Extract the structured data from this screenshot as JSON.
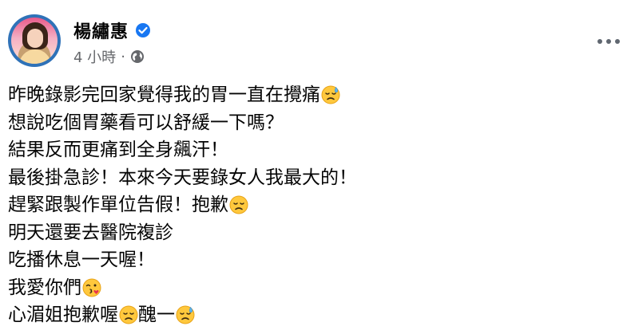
{
  "post": {
    "author_name": "楊繡惠",
    "timestamp": "4 小時",
    "separator": "·",
    "verified_icon": "verified-badge-icon",
    "privacy_icon": "globe-icon",
    "more_icon": "more-options-icon",
    "colors": {
      "verified": "#1877f2",
      "meta_text": "#65676b",
      "body_text": "#050505",
      "avatar_ring": "#2f72b8"
    },
    "lines": [
      {
        "text": "昨晚錄影完回家覺得我的胃一直在攪痛",
        "emoji": "downcast-sweat-face"
      },
      {
        "text": "想說吃個胃藥看可以舒緩一下嗎？",
        "emoji": ""
      },
      {
        "text": "結果反而更痛到全身飆汗！",
        "emoji": ""
      },
      {
        "text": "最後掛急診！本來今天要錄女人我最大的！",
        "emoji": ""
      },
      {
        "text": "趕緊跟製作單位告假！抱歉",
        "emoji": "disappointed-face"
      },
      {
        "text": "明天還要去醫院複診",
        "emoji": ""
      },
      {
        "text": "吃播休息一天喔！",
        "emoji": ""
      },
      {
        "text": "我愛你們",
        "emoji": "face-blowing-kiss"
      },
      {
        "text": "心湄姐抱歉喔",
        "emoji": "disappointed-face",
        "text2": "醜一",
        "emoji2": "downcast-sweat-face"
      }
    ]
  }
}
